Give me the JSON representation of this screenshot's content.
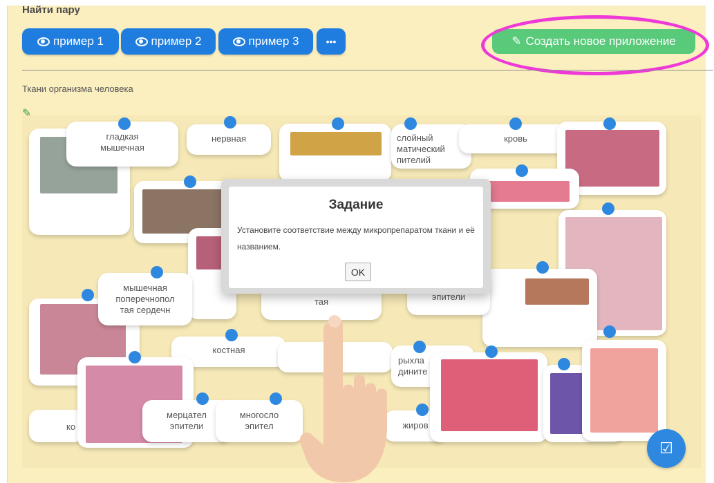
{
  "app": {
    "title": "Найти пару",
    "section_title": "Ткани организма человека"
  },
  "toolbar": {
    "example_buttons": [
      {
        "label": "пример 1"
      },
      {
        "label": "пример 2"
      },
      {
        "label": "пример 3"
      }
    ],
    "more_label": "•••",
    "create_label": "Создать новое приложение"
  },
  "cards": {
    "smooth_muscle": "гладкая\nмышечная",
    "nervous": "нервная",
    "stratified": "слойный\nматический\nпителий",
    "blood": "кровь",
    "cardiac_muscle": "мышечная\nпоперечнопол\nтая сердечн",
    "bone": "костная",
    "loose": "рыхла\nдините",
    "ciliated": "мерцател\nэпители",
    "multilayer": "многосло\nэпител",
    "fat": "жиров",
    "connective": "тая",
    "epithelium": "й\nэпители",
    "left_bottom": "ко"
  },
  "modal": {
    "title": "Задание",
    "text": "Установите соответствие между микропрепаратом ткани и её названием.",
    "ok_label": "OK"
  },
  "icons": {
    "eye": "eye-icon",
    "edit": "edit-icon",
    "check": "check-icon"
  }
}
